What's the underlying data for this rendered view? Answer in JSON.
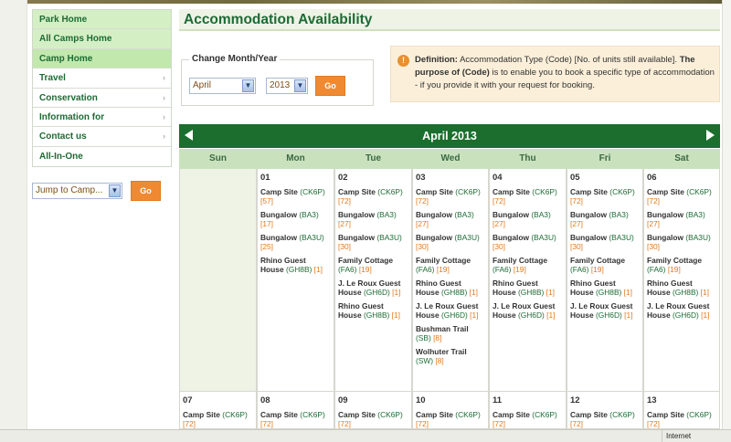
{
  "nav": {
    "items": [
      {
        "label": "Park Home",
        "style": "green",
        "chevron": false
      },
      {
        "label": "All Camps Home",
        "style": "green",
        "chevron": false
      },
      {
        "label": "Camp Home",
        "style": "green-strong",
        "chevron": false
      },
      {
        "label": "Travel",
        "style": "",
        "chevron": true
      },
      {
        "label": "Conservation",
        "style": "",
        "chevron": true
      },
      {
        "label": "Information for",
        "style": "",
        "chevron": true
      },
      {
        "label": "Contact us",
        "style": "",
        "chevron": true
      },
      {
        "label": "All-In-One",
        "style": "",
        "chevron": false
      }
    ],
    "chevron_glyph": "›"
  },
  "jump": {
    "selected": "Jump to Camp...",
    "go_label": "Go"
  },
  "page_title": "Accommodation Availability",
  "month_year": {
    "legend": "Change Month/Year",
    "month_selected": "April",
    "year_selected": "2013",
    "go_label": "Go"
  },
  "definition": {
    "label": "Definition:",
    "text": " Accommodation Type (Code) [No. of units still available]. ",
    "purpose_label": "The purpose of (Code)",
    "purpose_text": " is to enable you to book a specific type of accommodation - if you provide it with your request for booking."
  },
  "calendar": {
    "month_title": "April 2013",
    "weekdays": [
      "Sun",
      "Mon",
      "Tue",
      "Wed",
      "Thu",
      "Fri",
      "Sat"
    ],
    "week1": [
      {
        "day": "",
        "entries": []
      },
      {
        "day": "01",
        "entries": [
          {
            "name": "Camp Site",
            "code": "(CK6P)",
            "units": "[57]"
          },
          {
            "name": "Bungalow",
            "code": "(BA3)",
            "units": "[17]"
          },
          {
            "name": "Bungalow",
            "code": "(BA3U)",
            "units": "[25]"
          },
          {
            "name": "Rhino Guest House",
            "code": "(GH8B)",
            "units": "[1]"
          }
        ]
      },
      {
        "day": "02",
        "entries": [
          {
            "name": "Camp Site",
            "code": "(CK6P)",
            "units": "[72]"
          },
          {
            "name": "Bungalow",
            "code": "(BA3)",
            "units": "[27]"
          },
          {
            "name": "Bungalow",
            "code": "(BA3U)",
            "units": "[30]"
          },
          {
            "name": "Family Cottage",
            "code": "(FA6)",
            "units": "[19]"
          },
          {
            "name": "J. Le Roux Guest House",
            "code": "(GH6D)",
            "units": "[1]"
          },
          {
            "name": "Rhino Guest House",
            "code": "(GH8B)",
            "units": "[1]"
          }
        ]
      },
      {
        "day": "03",
        "entries": [
          {
            "name": "Camp Site",
            "code": "(CK6P)",
            "units": "[72]"
          },
          {
            "name": "Bungalow",
            "code": "(BA3)",
            "units": "[27]"
          },
          {
            "name": "Bungalow",
            "code": "(BA3U)",
            "units": "[30]"
          },
          {
            "name": "Family Cottage",
            "code": "(FA6)",
            "units": "[19]"
          },
          {
            "name": "Rhino Guest House",
            "code": "(GH8B)",
            "units": "[1]"
          },
          {
            "name": "J. Le Roux Guest House",
            "code": "(GH6D)",
            "units": "[1]"
          },
          {
            "name": "Bushman Trail",
            "code": "(SB)",
            "units": "[8]"
          },
          {
            "name": "Wolhuter Trail",
            "code": "(SW)",
            "units": "[8]"
          }
        ]
      },
      {
        "day": "04",
        "entries": [
          {
            "name": "Camp Site",
            "code": "(CK6P)",
            "units": "[72]"
          },
          {
            "name": "Bungalow",
            "code": "(BA3)",
            "units": "[27]"
          },
          {
            "name": "Bungalow",
            "code": "(BA3U)",
            "units": "[30]"
          },
          {
            "name": "Family Cottage",
            "code": "(FA6)",
            "units": "[19]"
          },
          {
            "name": "Rhino Guest House",
            "code": "(GH8B)",
            "units": "[1]"
          },
          {
            "name": "J. Le Roux Guest House",
            "code": "(GH6D)",
            "units": "[1]"
          }
        ]
      },
      {
        "day": "05",
        "entries": [
          {
            "name": "Camp Site",
            "code": "(CK6P)",
            "units": "[72]"
          },
          {
            "name": "Bungalow",
            "code": "(BA3)",
            "units": "[27]"
          },
          {
            "name": "Bungalow",
            "code": "(BA3U)",
            "units": "[30]"
          },
          {
            "name": "Family Cottage",
            "code": "(FA6)",
            "units": "[19]"
          },
          {
            "name": "Rhino Guest House",
            "code": "(GH8B)",
            "units": "[1]"
          },
          {
            "name": "J. Le Roux Guest House",
            "code": "(GH6D)",
            "units": "[1]"
          }
        ]
      },
      {
        "day": "06",
        "entries": [
          {
            "name": "Camp Site",
            "code": "(CK6P)",
            "units": "[72]"
          },
          {
            "name": "Bungalow",
            "code": "(BA3)",
            "units": "[27]"
          },
          {
            "name": "Bungalow",
            "code": "(BA3U)",
            "units": "[30]"
          },
          {
            "name": "Family Cottage",
            "code": "(FA6)",
            "units": "[19]"
          },
          {
            "name": "Rhino Guest House",
            "code": "(GH8B)",
            "units": "[1]"
          },
          {
            "name": "J. Le Roux Guest House",
            "code": "(GH6D)",
            "units": "[1]"
          }
        ]
      }
    ],
    "week2": [
      {
        "day": "07",
        "entries": [
          {
            "name": "Camp Site",
            "code": "(CK6P)",
            "units": "[72]"
          }
        ]
      },
      {
        "day": "08",
        "entries": [
          {
            "name": "Camp Site",
            "code": "(CK6P)",
            "units": "[72]"
          }
        ]
      },
      {
        "day": "09",
        "entries": [
          {
            "name": "Camp Site",
            "code": "(CK6P)",
            "units": "[72]"
          }
        ]
      },
      {
        "day": "10",
        "entries": [
          {
            "name": "Camp Site",
            "code": "(CK6P)",
            "units": "[72]"
          }
        ]
      },
      {
        "day": "11",
        "entries": [
          {
            "name": "Camp Site",
            "code": "(CK6P)",
            "units": "[72]"
          }
        ]
      },
      {
        "day": "12",
        "entries": [
          {
            "name": "Camp Site",
            "code": "(CK6P)",
            "units": "[72]"
          }
        ]
      },
      {
        "day": "13",
        "entries": [
          {
            "name": "Camp Site",
            "code": "(CK6P)",
            "units": "[72]"
          }
        ]
      }
    ]
  },
  "statusbar": {
    "zone": "Internet"
  },
  "colors": {
    "brand_green": "#1b6e2d",
    "accent_orange": "#ef8a33",
    "units_orange": "#e07a1e"
  }
}
